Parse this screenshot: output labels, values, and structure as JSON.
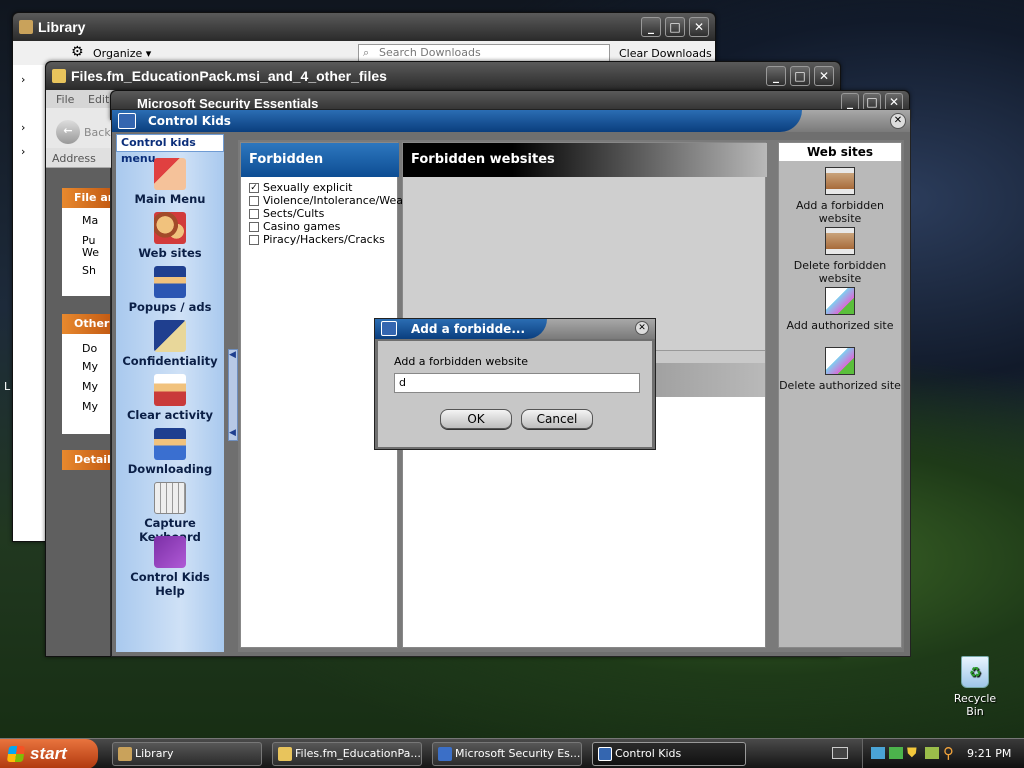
{
  "library": {
    "title": "Library",
    "organize": "Organize ▾",
    "search_placeholder": "Search Downloads",
    "clear_downloads": "Clear Downloads"
  },
  "files_window": {
    "title": "Files.fm_EducationPack.msi_and_4_other_files",
    "menu": [
      "File",
      "Edit"
    ],
    "back": "Back",
    "address": "Address",
    "file_tasks": "File an",
    "other_places": "Other",
    "details": "Details",
    "tasks": [
      "Ma",
      "Pu",
      "We",
      "Sh"
    ],
    "places": [
      "Do",
      "My",
      "My",
      "My"
    ]
  },
  "mse": {
    "title": "Microsoft Security Essentials"
  },
  "control_kids": {
    "title": "Control Kids",
    "menu_header": "Control kids menu",
    "menu": [
      {
        "label": "Main Menu",
        "icon": "main-menu-icon"
      },
      {
        "label": "Web sites",
        "icon": "web-sites-icon"
      },
      {
        "label": "Popups / ads",
        "icon": "popups-icon"
      },
      {
        "label": "Confidentiality",
        "icon": "confidentiality-icon"
      },
      {
        "label": "Clear activity",
        "icon": "clear-activity-icon"
      },
      {
        "label": "Downloading",
        "icon": "downloading-icon"
      },
      {
        "label": "Capture Keyboard",
        "icon": "keyboard-icon"
      },
      {
        "label": "Control Kids Help",
        "icon": "help-book-icon"
      }
    ],
    "categories_header": "Forbidden categories",
    "categories": [
      {
        "label": "Sexually explicit",
        "checked": true
      },
      {
        "label": "Violence/Intolerance/Weapo",
        "checked": false
      },
      {
        "label": "Sects/Cults",
        "checked": false
      },
      {
        "label": "Casino games",
        "checked": false
      },
      {
        "label": "Piracy/Hackers/Cracks",
        "checked": false
      }
    ],
    "websites_header": "Forbidden websites",
    "actions_header": "Web sites",
    "actions": [
      "Add a  forbidden website",
      "Delete forbidden website",
      "Add authorized site",
      "Delete authorized site"
    ]
  },
  "dialog": {
    "title": "Add a forbidde...",
    "label": "Add a forbidden website",
    "value": "d",
    "ok": "OK",
    "cancel": "Cancel"
  },
  "desktop": {
    "recycle_bin": "Recycle Bin",
    "left_edge": "L"
  },
  "taskbar": {
    "start": "start",
    "tasks": [
      "Library",
      "Files.fm_EducationPa...",
      "Microsoft Security Es...",
      "Control Kids"
    ],
    "time": "9:21 PM"
  }
}
